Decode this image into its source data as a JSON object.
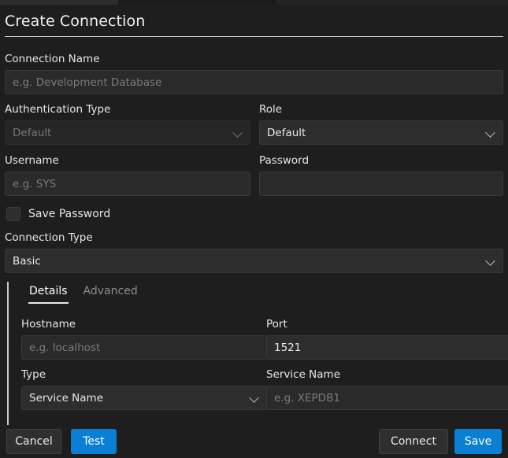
{
  "window": {
    "title": "Create Connection"
  },
  "theme": {
    "background": "#1e1e1e",
    "accent_blue": "#0b7fd4",
    "input_background": "#2d2d2d",
    "text": "#e8e8e8",
    "muted_text": "#7b7b7b"
  },
  "form": {
    "connection_name": {
      "label": "Connection Name",
      "value": "",
      "placeholder": "e.g. Development Database"
    },
    "authentication_type": {
      "label": "Authentication Type",
      "value": "Default",
      "disabled": true
    },
    "role": {
      "label": "Role",
      "value": "Default",
      "disabled": false
    },
    "username": {
      "label": "Username",
      "value": "",
      "placeholder": "e.g. SYS"
    },
    "password": {
      "label": "Password",
      "value": "",
      "placeholder": ""
    },
    "save_password": {
      "label": "Save Password",
      "checked": false
    },
    "connection_type": {
      "label": "Connection Type",
      "value": "Basic"
    }
  },
  "tabs": {
    "items": [
      {
        "label": "Details",
        "active": true
      },
      {
        "label": "Advanced",
        "active": false
      }
    ]
  },
  "details": {
    "hostname": {
      "label": "Hostname",
      "value": "",
      "placeholder": "e.g. localhost"
    },
    "port": {
      "label": "Port",
      "value": "1521",
      "placeholder": ""
    },
    "type": {
      "label": "Type",
      "value": "Service Name"
    },
    "service_name": {
      "label": "Service Name",
      "value": "",
      "placeholder": "e.g. XEPDB1"
    }
  },
  "buttons": {
    "cancel": "Cancel",
    "test": "Test",
    "connect": "Connect",
    "save": "Save"
  }
}
